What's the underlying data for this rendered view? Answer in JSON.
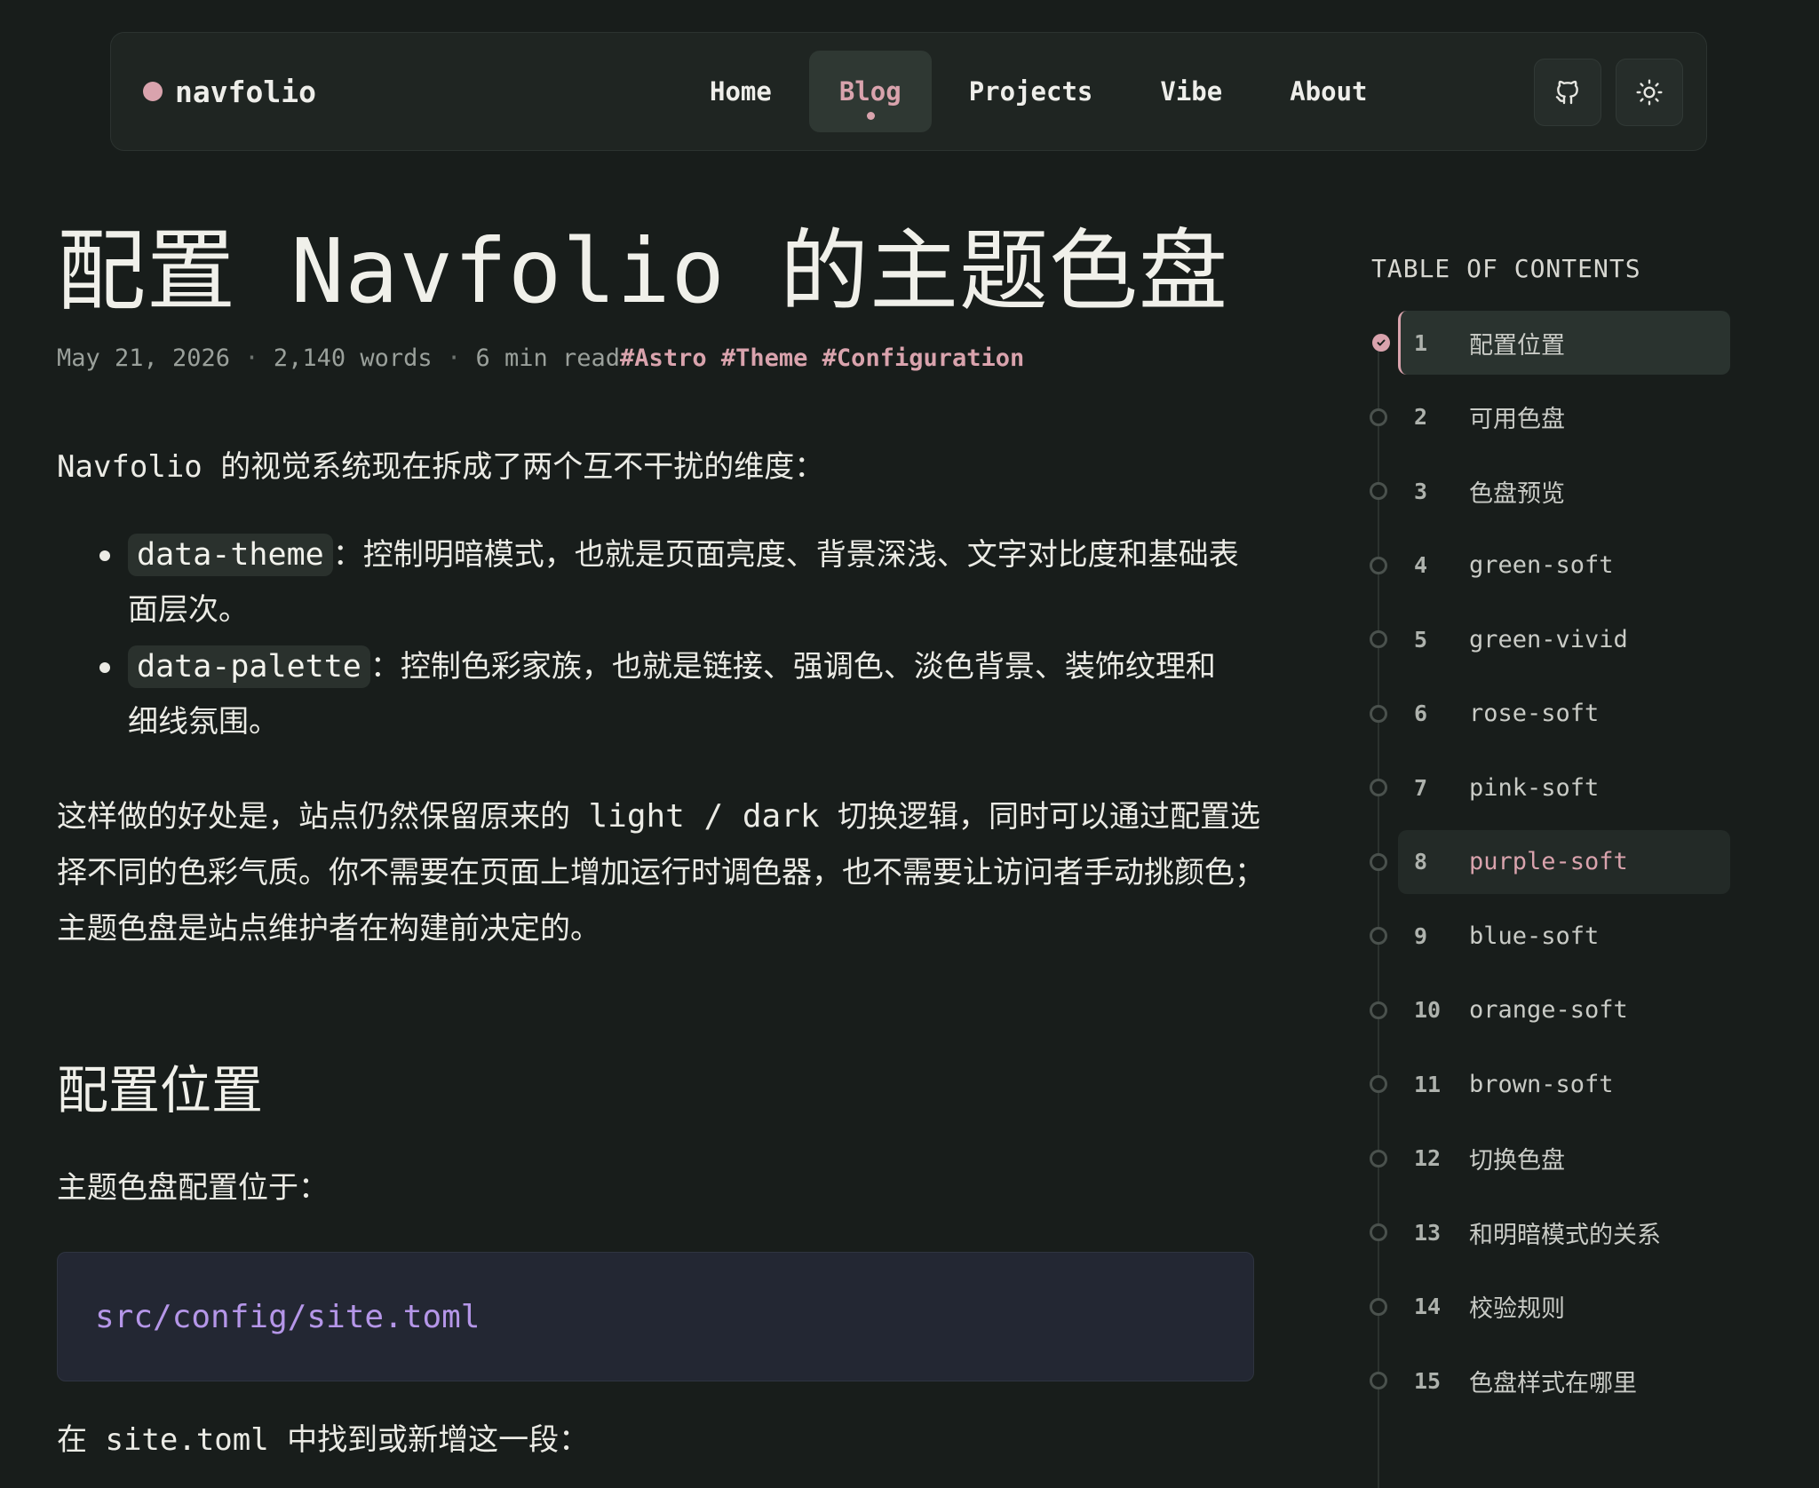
{
  "header": {
    "brand": "navfolio",
    "nav": [
      {
        "label": "Home",
        "active": false
      },
      {
        "label": "Blog",
        "active": true
      },
      {
        "label": "Projects",
        "active": false
      },
      {
        "label": "Vibe",
        "active": false
      },
      {
        "label": "About",
        "active": false
      }
    ],
    "icons": {
      "github": "github-icon",
      "theme": "sun-icon"
    }
  },
  "article": {
    "title": "配置 Navfolio 的主题色盘",
    "meta": {
      "date": "May 21, 2026",
      "separator": "·",
      "words": "2,140 words",
      "read_time": "6 min read",
      "tags": [
        "#Astro",
        "#Theme",
        "#Configuration"
      ]
    },
    "intro": "Navfolio 的视觉系统现在拆成了两个互不干扰的维度：",
    "bullets": [
      {
        "code": "data-theme",
        "text": "：控制明暗模式，也就是页面亮度、背景深浅、文字对比度和基础表面层次。"
      },
      {
        "code": "data-palette",
        "text": "：控制色彩家族，也就是链接、强调色、淡色背景、装饰纹理和细线氛围。"
      }
    ],
    "para2": {
      "before": "这样做的好处是，站点仍然保留原来的 ",
      "code": "light / dark",
      "after": " 切换逻辑，同时可以通过配置选择不同的色彩气质。你不需要在页面上增加运行时调色器，也不需要让访问者手动挑颜色；主题色盘是站点维护者在构建前决定的。"
    },
    "section_heading": "配置位置",
    "para3": "主题色盘配置位于：",
    "code_block": "src/config/site.toml",
    "para4": "在 site.toml 中找到或新增这一段："
  },
  "toc": {
    "title": "TABLE OF CONTENTS",
    "items": [
      {
        "num": "1",
        "label": "配置位置",
        "state": "active"
      },
      {
        "num": "2",
        "label": "可用色盘",
        "state": ""
      },
      {
        "num": "3",
        "label": "色盘预览",
        "state": ""
      },
      {
        "num": "4",
        "label": "green-soft",
        "state": ""
      },
      {
        "num": "5",
        "label": "green-vivid",
        "state": ""
      },
      {
        "num": "6",
        "label": "rose-soft",
        "state": ""
      },
      {
        "num": "7",
        "label": "pink-soft",
        "state": ""
      },
      {
        "num": "8",
        "label": "purple-soft",
        "state": "hover"
      },
      {
        "num": "9",
        "label": "blue-soft",
        "state": ""
      },
      {
        "num": "10",
        "label": "orange-soft",
        "state": ""
      },
      {
        "num": "11",
        "label": "brown-soft",
        "state": ""
      },
      {
        "num": "12",
        "label": "切换色盘",
        "state": ""
      },
      {
        "num": "13",
        "label": "和明暗模式的关系",
        "state": ""
      },
      {
        "num": "14",
        "label": "校验规则",
        "state": ""
      },
      {
        "num": "15",
        "label": "色盘样式在哪里",
        "state": ""
      }
    ]
  },
  "colors": {
    "background": "#181d1b",
    "accent": "#d9a3ad",
    "code": "#b596e8"
  }
}
